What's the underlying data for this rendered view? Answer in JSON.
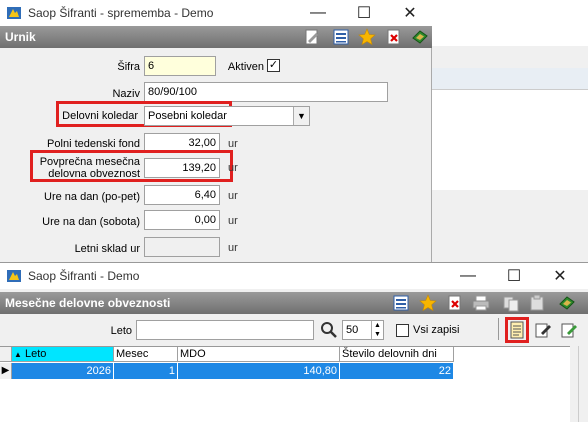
{
  "win1": {
    "title": "Saop Šifranti - sprememba - Demo",
    "controls": {
      "minimize": "—",
      "maximize": "☐",
      "close": "✕"
    },
    "section": "Urnik",
    "fields": {
      "sifra_label": "Šifra",
      "sifra_value": "6",
      "aktiven_label": "Aktiven",
      "aktiven_checked": "✓",
      "naziv_label": "Naziv",
      "naziv_value": "80/90/100",
      "koledar_label": "Delovni koledar",
      "koledar_value": "Posebni koledar",
      "polni_label": "Polni tedenski fond",
      "polni_value": "32,00",
      "povp_label_1": "Povprečna mesečna",
      "povp_label_2": "delovna obveznost",
      "povp_value": "139,20",
      "ure_dan_label": "Ure na dan (po-pet)",
      "ure_dan_value": "6,40",
      "ure_sob_label": "Ure na dan (sobota)",
      "ure_sob_value": "0,00",
      "letni_label": "Letni sklad ur",
      "letni_value": "",
      "unit": "ur"
    },
    "toolbar_icons": [
      "edit-icon",
      "list-icon",
      "star-icon",
      "delete-icon",
      "exit-icon"
    ]
  },
  "win2": {
    "title": "Saop Šifranti - Demo",
    "controls": {
      "minimize": "—",
      "maximize": "☐",
      "close": "✕"
    },
    "section": "Mesečne delovne obveznosti",
    "filter": {
      "leto_label": "Leto",
      "leto_value": "",
      "count_value": "50",
      "vsi_label": "Vsi zapisi"
    },
    "columns": [
      "Leto",
      "Mesec",
      "MDO",
      "Število delovnih dni"
    ],
    "rows": [
      {
        "leto": "2026",
        "mesec": "1",
        "mdo": "140,80",
        "dni": "22"
      }
    ],
    "toolbar_icons": [
      "list-icon",
      "star-icon",
      "delete-icon",
      "print-icon",
      "copy-icon",
      "paste-icon",
      "exit-icon"
    ],
    "action_icons": [
      "new-record-icon",
      "edit-record-icon",
      "edit-all-icon"
    ]
  },
  "colors": {
    "highlight_red": "#e0201f",
    "field_yellow": "#ffffdc",
    "selection_blue": "#1e88e5",
    "header_cyan": "#00e5ff",
    "section_gray": "#7f7f7f"
  }
}
